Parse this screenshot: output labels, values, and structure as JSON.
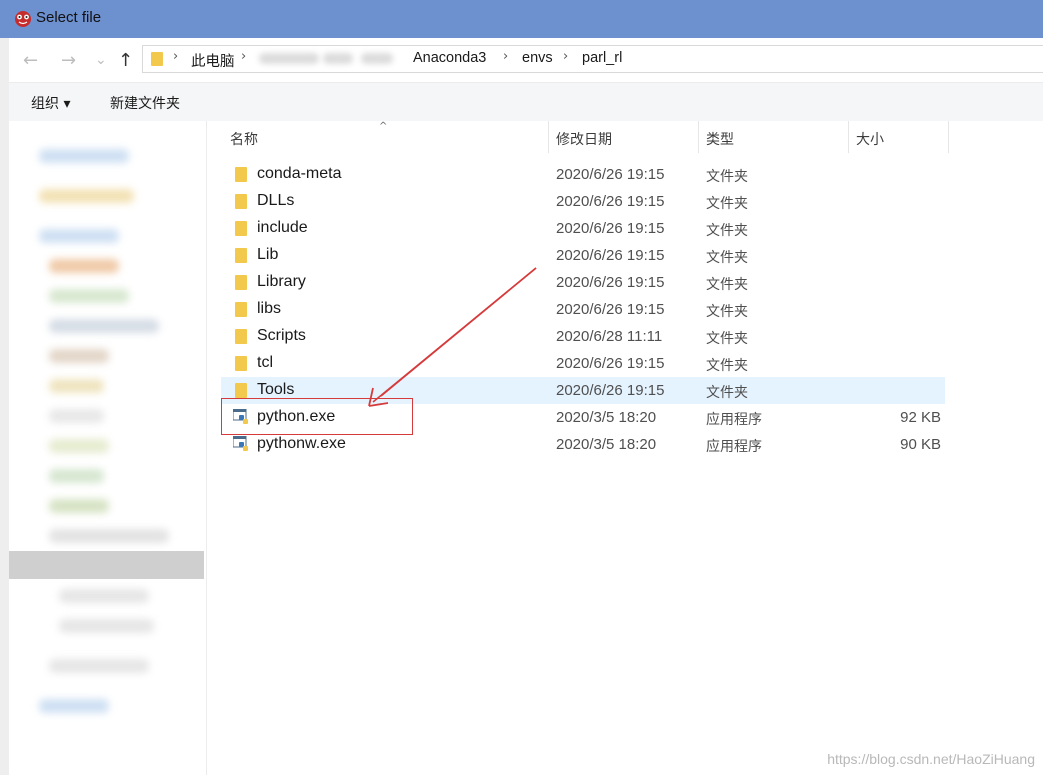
{
  "window": {
    "title": "Select file"
  },
  "nav": {
    "back": "←",
    "forward": "→",
    "dropdown": "⌄",
    "up": "↑"
  },
  "address": {
    "crumbs": [
      "此电脑",
      "Anaconda3",
      "envs",
      "parl_rl"
    ],
    "separator": "›"
  },
  "toolbar": {
    "organize_label": "组织 ▾",
    "new_folder_label": "新建文件夹"
  },
  "columns": {
    "name": "名称",
    "modified": "修改日期",
    "type": "类型",
    "size": "大小"
  },
  "files": [
    {
      "name": "conda-meta",
      "modified": "2020/6/26 19:15",
      "type": "文件夹",
      "size": "",
      "icon": "folder-icon"
    },
    {
      "name": "DLLs",
      "modified": "2020/6/26 19:15",
      "type": "文件夹",
      "size": "",
      "icon": "folder-icon"
    },
    {
      "name": "include",
      "modified": "2020/6/26 19:15",
      "type": "文件夹",
      "size": "",
      "icon": "folder-icon"
    },
    {
      "name": "Lib",
      "modified": "2020/6/26 19:15",
      "type": "文件夹",
      "size": "",
      "icon": "folder-icon"
    },
    {
      "name": "Library",
      "modified": "2020/6/26 19:15",
      "type": "文件夹",
      "size": "",
      "icon": "folder-icon"
    },
    {
      "name": "libs",
      "modified": "2020/6/26 19:15",
      "type": "文件夹",
      "size": "",
      "icon": "folder-icon"
    },
    {
      "name": "Scripts",
      "modified": "2020/6/28 11:11",
      "type": "文件夹",
      "size": "",
      "icon": "folder-icon"
    },
    {
      "name": "tcl",
      "modified": "2020/6/26 19:15",
      "type": "文件夹",
      "size": "",
      "icon": "folder-icon"
    },
    {
      "name": "Tools",
      "modified": "2020/6/26 19:15",
      "type": "文件夹",
      "size": "",
      "icon": "folder-icon"
    },
    {
      "name": "python.exe",
      "modified": "2020/3/5 18:20",
      "type": "应用程序",
      "size": "92 KB",
      "icon": "python-exe-icon"
    },
    {
      "name": "pythonw.exe",
      "modified": "2020/3/5 18:20",
      "type": "应用程序",
      "size": "90 KB",
      "icon": "python-exe-icon"
    }
  ],
  "annotation": {
    "highlight_color": "#d63b3b"
  },
  "watermark": "https://blog.csdn.net/HaoZiHuang",
  "colors": {
    "titlebar": "#6d90cf",
    "hover_row": "#e5f3ff",
    "folder": "#f2c94c"
  }
}
